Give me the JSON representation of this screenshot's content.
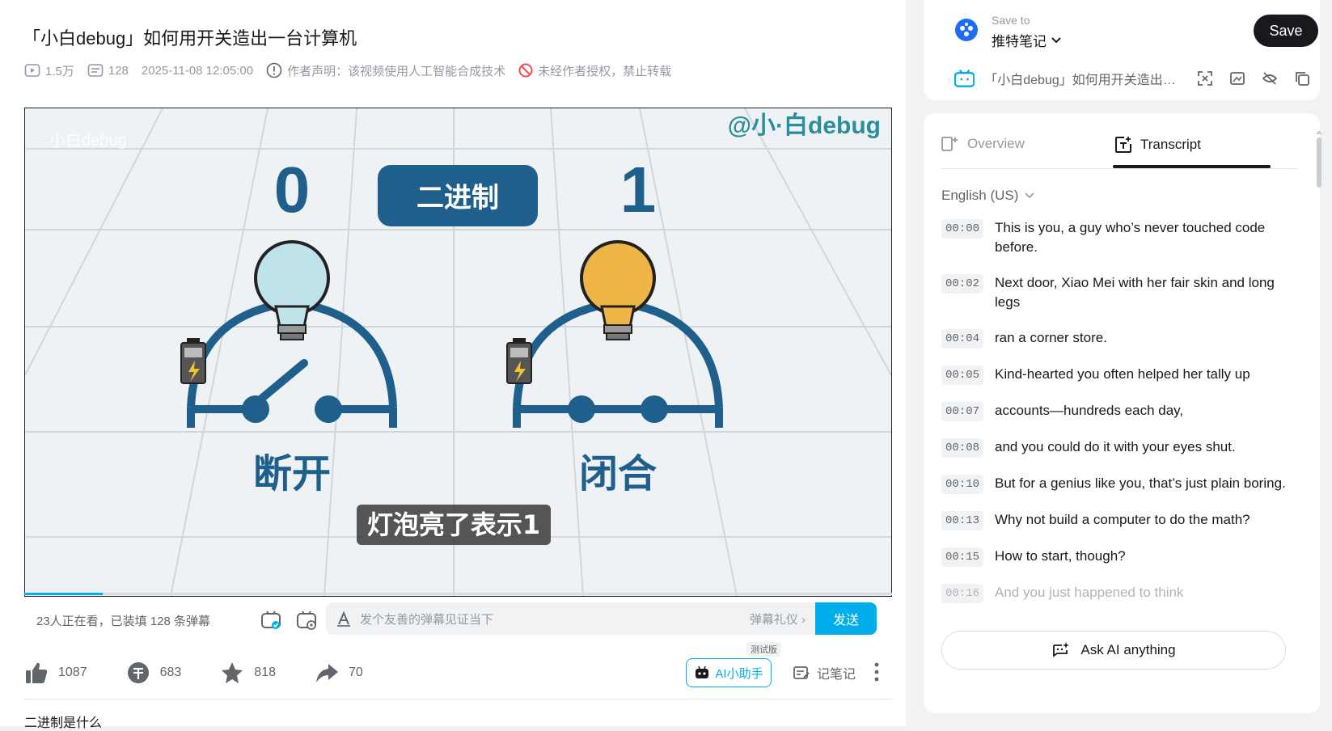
{
  "video": {
    "title": "「小白debug」如何用开关造出一台计算机",
    "views": "1.5万",
    "danmaku_count": "128",
    "datetime": "2025-11-08 12:05:00",
    "ai_notice": "作者声明：该视频使用人工智能合成技术",
    "no_repost": "未经作者授权，禁止转载"
  },
  "player": {
    "watermark_left": "小白debug",
    "watermark_right": "@小·白debug",
    "binary_badge": "二进制",
    "num_zero": "0",
    "num_one": "1",
    "label_open": "断开",
    "label_closed": "闭合",
    "subtitle": "灯泡亮了表示1",
    "progress": 0.09
  },
  "danmaku_bar": {
    "watching": "23人正在看，已装填 128 条弹幕",
    "placeholder": "发个友善的弹幕见证当下",
    "etiquette": "弹幕礼仪 ›",
    "send": "发送"
  },
  "actions": {
    "like": "1087",
    "coin": "683",
    "favorite": "818",
    "share": "70",
    "ai_assistant": "AI小助手",
    "test_tag": "测试版",
    "notes": "记笔记"
  },
  "description_peek": "二进制是什么",
  "save_panel": {
    "save_to_label": "Save to",
    "save_to_value": "推特笔记",
    "save_button": "Save",
    "video_title": "「小白debug」如何用开关造出一台计算机"
  },
  "transcript_panel": {
    "tab_overview": "Overview",
    "tab_transcript": "Transcript",
    "language": "English (US)",
    "ask_ai": "Ask AI anything",
    "lines": [
      {
        "time": "00:00",
        "text": "This is you, a guy who’s never touched code before."
      },
      {
        "time": "00:02",
        "text": "Next door, Xiao Mei with her fair skin and long legs"
      },
      {
        "time": "00:04",
        "text": "ran a corner store."
      },
      {
        "time": "00:05",
        "text": "Kind-hearted you often helped her tally up"
      },
      {
        "time": "00:07",
        "text": "accounts—hundreds each day,"
      },
      {
        "time": "00:08",
        "text": "and you could do it with your eyes shut."
      },
      {
        "time": "00:10",
        "text": "But for a genius like you, that’s just plain boring."
      },
      {
        "time": "00:13",
        "text": "Why not build a computer to do the math?"
      },
      {
        "time": "00:15",
        "text": "How to start, though?"
      },
      {
        "time": "00:16",
        "text": "And you just happened to think"
      }
    ]
  },
  "colors": {
    "accent": "#00aeec",
    "dark_blue": "#1f5f8b",
    "bulb_off": "#bfe3ea",
    "bulb_on": "#efb546"
  }
}
